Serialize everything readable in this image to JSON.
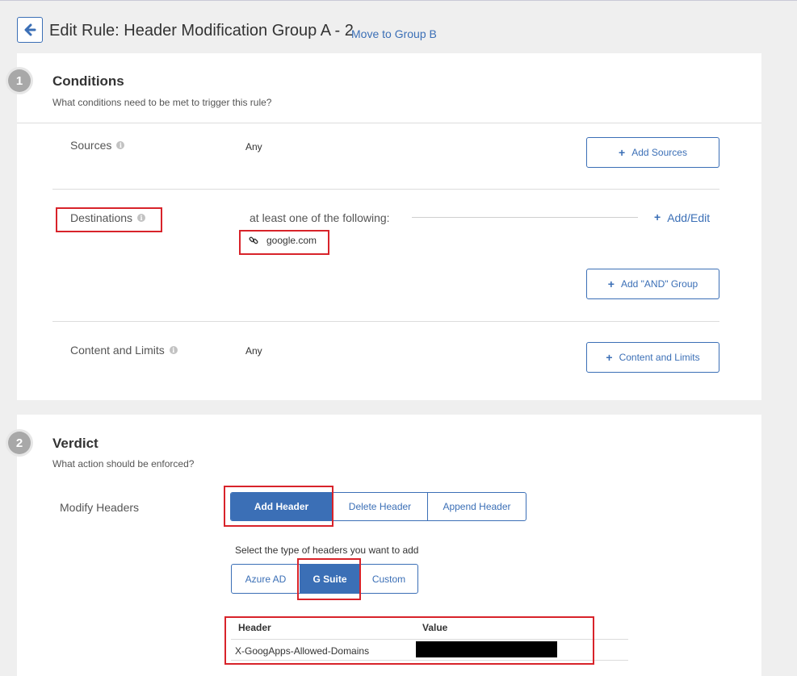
{
  "header": {
    "title": "Edit Rule: Header Modification Group A - 2",
    "move_link": "Move to Group B",
    "back_icon": "arrow-left-icon"
  },
  "conditions": {
    "step": "1",
    "title": "Conditions",
    "subtitle": "What conditions need to be met to trigger this rule?",
    "sources": {
      "label": "Sources",
      "value": "Any",
      "button": "Add Sources"
    },
    "destinations": {
      "label": "Destinations",
      "qualifier": "at least one of the following:",
      "add_edit": "Add/Edit",
      "items": [
        {
          "icon": "link-icon",
          "text": "google.com"
        }
      ],
      "and_group_button": "Add \"AND\" Group"
    },
    "content_limits": {
      "label": "Content and Limits",
      "value": "Any",
      "button": "Content and Limits"
    }
  },
  "verdict": {
    "step": "2",
    "title": "Verdict",
    "subtitle": "What action should be enforced?",
    "modify_label": "Modify Headers",
    "actions": [
      "Add Header",
      "Delete Header",
      "Append Header"
    ],
    "active_action": "Add Header",
    "type_prompt": "Select the type of headers you want to add",
    "types": [
      "Azure AD",
      "G Suite",
      "Custom"
    ],
    "active_type": "G Suite",
    "table": {
      "columns": [
        "Header",
        "Value"
      ],
      "rows": [
        {
          "header": "X-GoogApps-Allowed-Domains",
          "value": ""
        }
      ]
    }
  },
  "colors": {
    "accent": "#3b6fb6",
    "highlight": "#d8232a",
    "badge": "#a8a8a8"
  }
}
